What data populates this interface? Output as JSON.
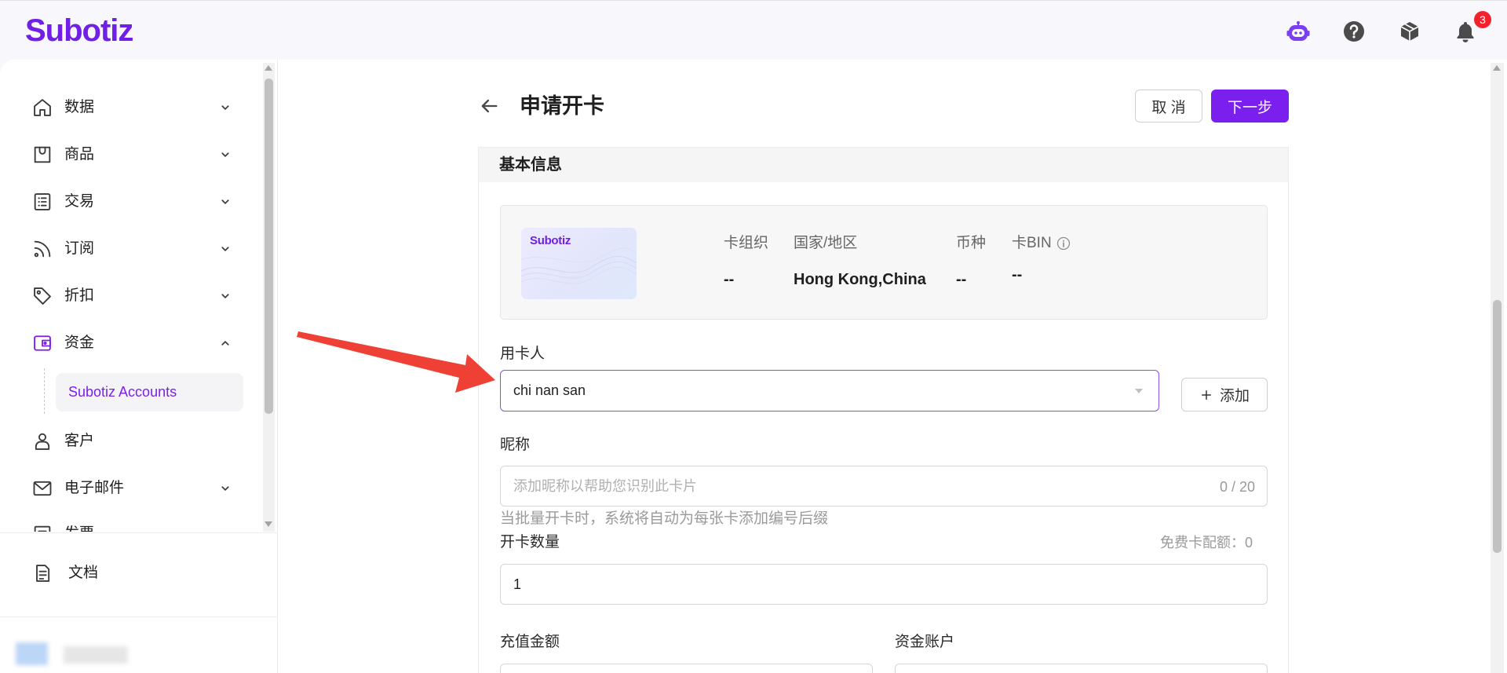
{
  "app": {
    "logo": "Subotiz"
  },
  "header": {
    "icons": [
      "ai-assistant-icon",
      "help-icon",
      "cube-icon",
      "bell-icon"
    ],
    "notification_count": "3"
  },
  "sidebar": {
    "items": [
      {
        "label": "数据",
        "icon": "home-icon"
      },
      {
        "label": "商品",
        "icon": "shop-icon"
      },
      {
        "label": "交易",
        "icon": "list-icon"
      },
      {
        "label": "订阅",
        "icon": "rss-icon"
      },
      {
        "label": "折扣",
        "icon": "tag-icon"
      },
      {
        "label": "资金",
        "icon": "wallet-icon",
        "expanded": true,
        "children": [
          {
            "label": "Subotiz Accounts",
            "selected": true
          }
        ]
      },
      {
        "label": "客户",
        "icon": "user-icon"
      },
      {
        "label": "电子邮件",
        "icon": "mail-icon"
      },
      {
        "label": "发票",
        "icon": "invoice-icon"
      }
    ],
    "docs": {
      "label": "文档",
      "icon": "doc-icon"
    }
  },
  "page": {
    "title": "申请开卡",
    "cancel_label": "取 消",
    "next_label": "下一步"
  },
  "form": {
    "section_title": "基本信息",
    "card": {
      "brand_text": "Subotiz",
      "columns": [
        {
          "label": "卡组织",
          "value": "--"
        },
        {
          "label": "国家/地区",
          "value": "Hong Kong,China"
        },
        {
          "label": "币种",
          "value": "--"
        },
        {
          "label": "卡BIN",
          "value": "--"
        }
      ]
    },
    "cardholder": {
      "label": "用卡人",
      "value": "chi nan san",
      "add_label": "添加"
    },
    "nickname": {
      "label": "昵称",
      "placeholder": "添加昵称以帮助您识别此卡片",
      "counter": "0 / 20",
      "hint": "当批量开卡时，系统将自动为每张卡添加编号后缀"
    },
    "quantity": {
      "label": "开卡数量",
      "quota": "免费卡配额：0",
      "value": "1"
    },
    "amount": {
      "label": "充值金额"
    },
    "account": {
      "label": "资金账户"
    }
  },
  "colors": {
    "brand": "#7b1fee",
    "badge": "#f5222d",
    "selected_bg": "#f4f4f6",
    "annotation_arrow": "#ee4035"
  }
}
